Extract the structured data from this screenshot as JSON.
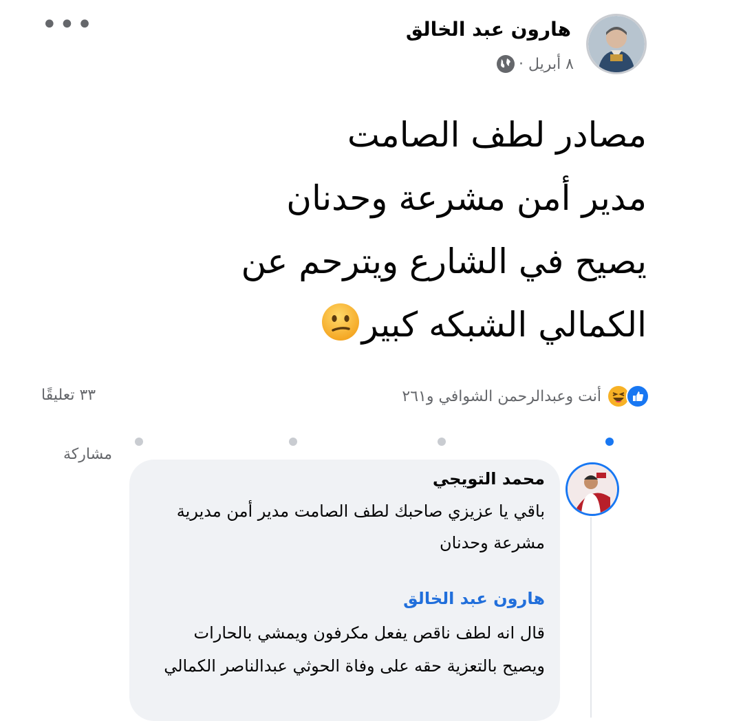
{
  "post": {
    "author": "هارون عبد الخالق",
    "date": "٨ أبريل ·",
    "more_label": "•••",
    "lines": [
      "مصادر لطف الصامت",
      "مدير أمن مشرعة وحدنان",
      "يصيح في الشارع ويترحم عن",
      "الكمالي الشبكه كبير"
    ]
  },
  "stats": {
    "reactions_text": "أنت وعبدالرحمن الشوافي و٢٦١",
    "comments_count": "٣٣ تعليقًا",
    "share_label": "مشاركة"
  },
  "comment": {
    "author": "محمد التويجي",
    "text": "باقي يا عزيزي صاحبك لطف الصامت مدير أمن مديرية مشرعة وحدنان",
    "mention": "هارون عبد الخالق",
    "text2": "قال انه لطف ناقص يفعل مكرفون ويمشي بالحارات ويصيح بالتعزية حقه على وفاة الحوثي عبدالناصر الكمالي"
  },
  "colors": {
    "like_blue": "#1877f2",
    "haha_yellow": "#f7b125",
    "secondary_text": "#65676b",
    "mention_blue": "#216fdb",
    "bubble_bg": "#f0f2f5"
  },
  "icons": [
    "more-icon",
    "globe-icon",
    "confused-emoji",
    "like-icon",
    "haha-icon"
  ]
}
